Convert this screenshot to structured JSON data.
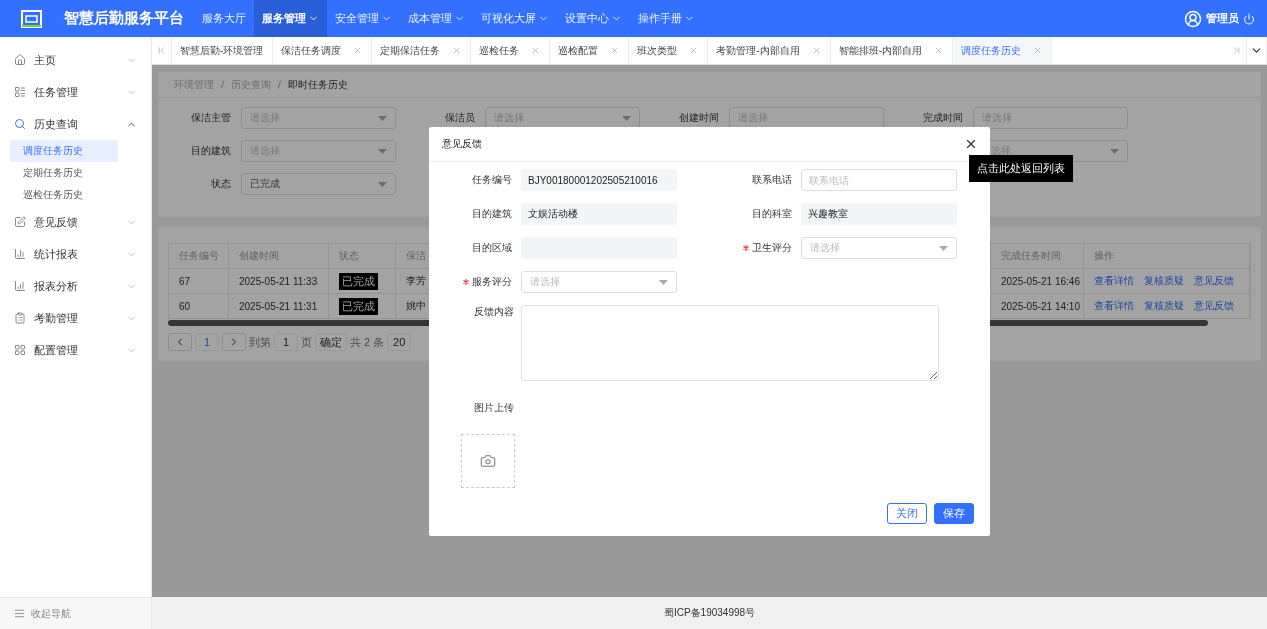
{
  "header": {
    "title": "智慧后勤服务平台",
    "user": "管理员",
    "nav": [
      {
        "label": "服务大厅",
        "selected": false,
        "dropdown": false
      },
      {
        "label": "服务管理",
        "selected": true,
        "dropdown": true
      },
      {
        "label": "安全管理",
        "selected": false,
        "dropdown": true
      },
      {
        "label": "成本管理",
        "selected": false,
        "dropdown": true
      },
      {
        "label": "可视化大屏",
        "selected": false,
        "dropdown": true
      },
      {
        "label": "设置中心",
        "selected": false,
        "dropdown": true
      },
      {
        "label": "操作手册",
        "selected": false,
        "dropdown": true
      }
    ]
  },
  "tabs": [
    {
      "label": "智慧后勤-环境管理",
      "selected": false,
      "closable": false
    },
    {
      "label": "保洁任务调度",
      "selected": false,
      "closable": true
    },
    {
      "label": "定期保洁任务",
      "selected": false,
      "closable": true
    },
    {
      "label": "巡检任务",
      "selected": false,
      "closable": true
    },
    {
      "label": "巡检配置",
      "selected": false,
      "closable": true
    },
    {
      "label": "班次类型",
      "selected": false,
      "closable": true
    },
    {
      "label": "考勤管理-内部自用",
      "selected": false,
      "closable": true
    },
    {
      "label": "智能排班-内部自用",
      "selected": false,
      "closable": true
    },
    {
      "label": "调度任务历史",
      "selected": true,
      "closable": true
    }
  ],
  "sidebar": {
    "collapse_label": "收起导航",
    "items": [
      {
        "label": "主页",
        "expanded": false
      },
      {
        "label": "任务管理",
        "expanded": false
      },
      {
        "label": "历史查询",
        "expanded": true,
        "children": [
          {
            "label": "调度任务历史",
            "selected": true
          },
          {
            "label": "定期任务历史",
            "selected": false
          },
          {
            "label": "巡检任务历史",
            "selected": false
          }
        ]
      },
      {
        "label": "意见反馈",
        "expanded": false
      },
      {
        "label": "统计报表",
        "expanded": false
      },
      {
        "label": "报表分析",
        "expanded": false
      },
      {
        "label": "考勤管理",
        "expanded": false
      },
      {
        "label": "配置管理",
        "expanded": false
      }
    ]
  },
  "breadcrumb": [
    "环境管理",
    "历史查询",
    "即时任务历史"
  ],
  "filters": [
    [
      {
        "label": "保洁主管",
        "placeholder": "请选择",
        "kind": "select"
      },
      {
        "label": "保洁员",
        "placeholder": "请选择",
        "kind": "select"
      },
      {
        "label": "创建时间",
        "placeholder": "请选择",
        "kind": "date"
      },
      {
        "label": "完成时间",
        "placeholder": "请选择",
        "kind": "date"
      }
    ],
    [
      {
        "label": "目的建筑",
        "placeholder": "请选择",
        "kind": "select"
      },
      {
        "placeholder": "选择",
        "kind": "select"
      }
    ],
    [
      {
        "label": "状态",
        "value": "已完成",
        "kind": "select"
      }
    ]
  ],
  "table": {
    "columns": [
      "任务编号",
      "创建时间",
      "状态",
      "保洁",
      "完成任务时间",
      "操作"
    ],
    "rows": [
      {
        "id": "67",
        "created": "2025-05-21 11:33",
        "status": "已完成",
        "column_4": "李芳",
        "finished": "2025-05-21 16:46",
        "actions": [
          "查看详情",
          "复核质疑",
          "意见反馈"
        ]
      },
      {
        "id": "60",
        "created": "2025-05-21 11:31",
        "status": "已完成",
        "column_4": "姚中",
        "finished": "2025-05-21 14:10",
        "actions": [
          "查看详情",
          "复核质疑",
          "意见反馈"
        ]
      }
    ],
    "pagination": {
      "page": "1",
      "goto_label": "到第",
      "goto_value": "1",
      "page_unit": "页",
      "confirm": "确定",
      "total": "共 2 条",
      "page_size": "20"
    }
  },
  "modal": {
    "title": "意见反馈",
    "tooltip": "点击此处返回列表",
    "fields": [
      {
        "label": "任务编号",
        "value": "BJY00180001202505210016",
        "kind": "readonly",
        "required": false
      },
      {
        "label": "联系电话",
        "placeholder": "联系电话",
        "kind": "input",
        "required": false
      },
      {
        "label": "目的建筑",
        "value": "文娱活动楼",
        "kind": "readonly",
        "required": false
      },
      {
        "label": "目的科室",
        "value": "兴趣教室",
        "kind": "readonly",
        "required": false
      },
      {
        "label": "目的区域",
        "kind": "readonly",
        "required": false
      },
      {
        "label": "卫生评分",
        "placeholder": "请选择",
        "kind": "select",
        "required": true
      },
      {
        "label": "服务评分",
        "placeholder": "请选择",
        "kind": "select",
        "required": true
      }
    ],
    "feedback_label": "反馈内容",
    "upload_label": "图片上传",
    "buttons": [
      {
        "label": "关闭",
        "kind": "secondary"
      },
      {
        "label": "保存",
        "kind": "primary"
      }
    ]
  },
  "footer": "蜀ICP备19034998号"
}
